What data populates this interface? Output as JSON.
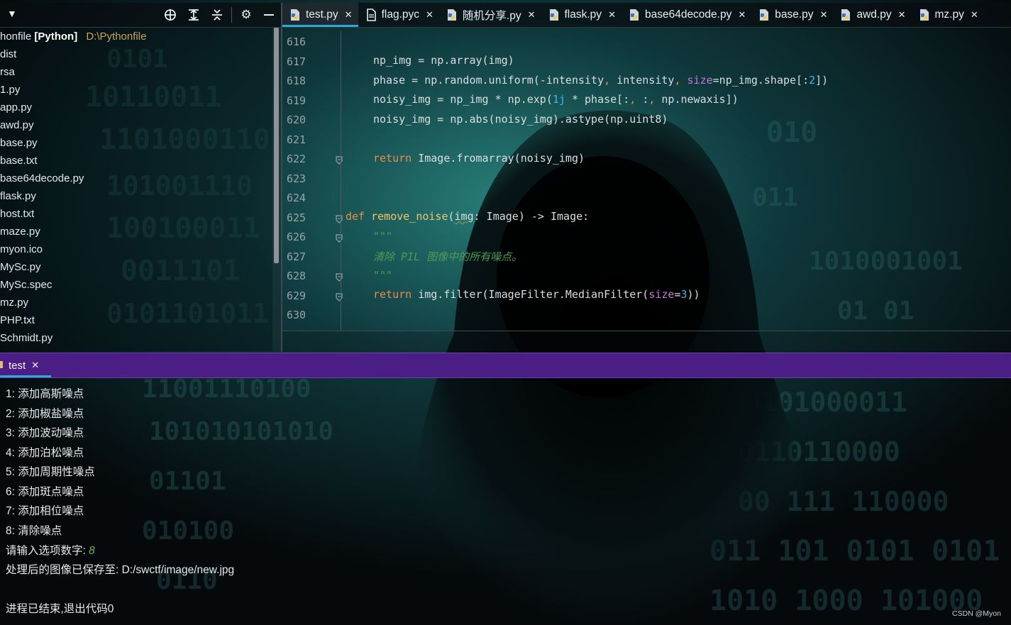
{
  "project": {
    "root": {
      "name": "honfile",
      "tag": "[Python]",
      "path": "D:\\Pythonfile"
    },
    "items": [
      "dist",
      "rsa",
      "1.py",
      "app.py",
      "awd.py",
      "base.py",
      "base.txt",
      "base64decode.py",
      "flask.py",
      "host.txt",
      "maze.py",
      "myon.ico",
      "MySc.py",
      "MySc.spec",
      "mz.py",
      "PHP.txt",
      "Schmidt.py"
    ],
    "toolbar_icons": [
      "crosshair-icon",
      "collapse-icon",
      "expand-icon",
      "gear-icon",
      "minimize-icon"
    ]
  },
  "tabs": [
    {
      "label": "test.py",
      "active": true
    },
    {
      "label": "flag.pyc",
      "active": false
    },
    {
      "label": "随机分享.py",
      "active": false
    },
    {
      "label": "flask.py",
      "active": false
    },
    {
      "label": "base64decode.py",
      "active": false
    },
    {
      "label": "base.py",
      "active": false
    },
    {
      "label": "awd.py",
      "active": false
    },
    {
      "label": "mz.py",
      "active": false
    }
  ],
  "editor": {
    "line_numbers": [
      "616",
      "617",
      "618",
      "619",
      "620",
      "621",
      "622",
      "623",
      "624",
      "625",
      "626",
      "627",
      "628",
      "629",
      "630"
    ],
    "code": {
      "l617": [
        "np_img = np.array(img)"
      ],
      "l618": [
        "phase = np.random.uniform(-intensity",
        ", ",
        "intensity",
        ", ",
        "size",
        "=np_img.shape[:",
        "2",
        "])"
      ],
      "l619": [
        "noisy_img = np_img * np.exp(",
        "1j",
        " * phase[:",
        ", ",
        ":",
        ", ",
        "np.newaxis])"
      ],
      "l620": [
        "noisy_img = np.abs(noisy_img).astype(np.uint8)"
      ],
      "l622": [
        "return",
        " Image.fromarray(noisy_img)"
      ],
      "l625": [
        "def",
        " ",
        "remove_noise",
        "(",
        "img",
        ": Image) -> Image:"
      ],
      "l626": [
        "\"\"\""
      ],
      "l627": [
        "清除 PIL 图像中的所有噪点。"
      ],
      "l628": [
        "\"\"\""
      ],
      "l629": [
        "return",
        " img.filter(ImageFilter.MedianFilter(",
        "size",
        "=",
        "3",
        "))"
      ]
    }
  },
  "run": {
    "tab_label": "test",
    "output": [
      "1: 添加高斯噪点",
      "2: 添加椒盐噪点",
      "3: 添加波动噪点",
      "4: 添加泊松噪点",
      "5: 添加周期性噪点",
      "6: 添加斑点噪点",
      "7: 添加相位噪点",
      "8: 清除噪点"
    ],
    "prompt": "请输入选项数字: ",
    "prompt_value": "8",
    "saved": "处理后的图像已保存至: D:/swctf/image/new.jpg",
    "exit": "进程已结束,退出代码0"
  },
  "watermark": "CSDN @Myon⁠"
}
